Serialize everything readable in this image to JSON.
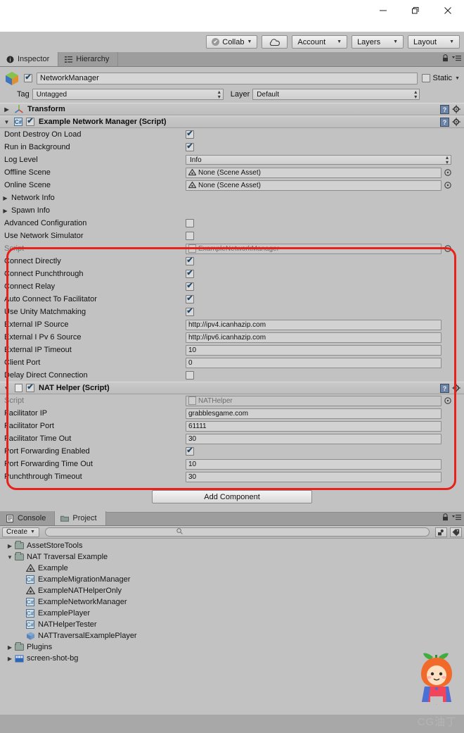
{
  "window": {
    "minimize_label": "Minimize",
    "maximize_label": "Restore",
    "close_label": "Close"
  },
  "toolbar": {
    "collab_label": "Collab",
    "cloud_label": "cloud-icon",
    "account_label": "Account",
    "layers_label": "Layers",
    "layout_label": "Layout"
  },
  "inspector": {
    "tabs": [
      {
        "label": "Inspector",
        "icon": "info-icon",
        "active": true
      },
      {
        "label": "Hierarchy",
        "icon": "hierarchy-icon",
        "active": false
      }
    ],
    "lock_icon": "lock-icon",
    "menu_icon": "panel-menu-icon",
    "object": {
      "enabled": true,
      "name": "NetworkManager",
      "static_label": "Static",
      "static_checked": false,
      "tag_label": "Tag",
      "tag_value": "Untagged",
      "layer_label": "Layer",
      "layer_value": "Default"
    },
    "components": [
      {
        "title": "Transform",
        "expanded": false,
        "has_enable_toggle": false,
        "icon": "transform-icon"
      },
      {
        "title": "Example Network Manager (Script)",
        "expanded": true,
        "has_enable_toggle": true,
        "enabled": true,
        "icon": "csharp-script-icon",
        "rows": [
          {
            "label": "Dont Destroy On Load",
            "type": "checkbox",
            "value": true
          },
          {
            "label": "Run in Background",
            "type": "checkbox",
            "value": true
          },
          {
            "label": "Log Level",
            "type": "dropdown",
            "value": "Info"
          },
          {
            "label": "Offline Scene",
            "type": "objectref",
            "value": "None (Scene Asset)"
          },
          {
            "label": "Online Scene",
            "type": "objectref",
            "value": "None (Scene Asset)"
          },
          {
            "label": "Network Info",
            "type": "foldout"
          },
          {
            "label": "Spawn Info",
            "type": "foldout"
          },
          {
            "label": "Advanced Configuration",
            "type": "checkbox",
            "value": false
          },
          {
            "label": "Use Network Simulator",
            "type": "checkbox",
            "value": false
          },
          {
            "label": "Script",
            "type": "scriptref",
            "value": "ExampleNetworkManager",
            "dim": true
          },
          {
            "label": "Connect Directly",
            "type": "checkbox",
            "value": true
          },
          {
            "label": "Connect Punchthrough",
            "type": "checkbox",
            "value": true
          },
          {
            "label": "Connect Relay",
            "type": "checkbox",
            "value": true
          },
          {
            "label": "Auto Connect To Facilitator",
            "type": "checkbox",
            "value": true
          },
          {
            "label": "Use Unity Matchmaking",
            "type": "checkbox",
            "value": true
          },
          {
            "label": "External IP Source",
            "type": "text",
            "value": "http://ipv4.icanhazip.com"
          },
          {
            "label": "External I Pv 6 Source",
            "type": "text",
            "value": "http://ipv6.icanhazip.com"
          },
          {
            "label": "External IP Timeout",
            "type": "text",
            "value": "10"
          },
          {
            "label": "Client Port",
            "type": "text",
            "value": "0"
          },
          {
            "label": "Delay Direct Connection",
            "type": "checkbox",
            "value": false
          }
        ]
      },
      {
        "title": "NAT Helper (Script)",
        "expanded": true,
        "has_enable_toggle": true,
        "enabled": true,
        "icon": "script-icon",
        "rows": [
          {
            "label": "Script",
            "type": "scriptref",
            "value": "NATHelper",
            "dim": true
          },
          {
            "label": "Facilitator IP",
            "type": "text",
            "value": "grabblesgame.com"
          },
          {
            "label": "Facilitator Port",
            "type": "text",
            "value": "61111"
          },
          {
            "label": "Facilitator Time Out",
            "type": "text",
            "value": "30"
          },
          {
            "label": "Port Forwarding Enabled",
            "type": "checkbox",
            "value": true
          },
          {
            "label": "Port Forwarding Time Out",
            "type": "text",
            "value": "10"
          },
          {
            "label": "Punchthrough Timeout",
            "type": "text",
            "value": "30"
          }
        ]
      }
    ],
    "add_component_label": "Add Component",
    "highlight_color": "#e8211b"
  },
  "project": {
    "tabs": [
      {
        "label": "Console",
        "icon": "console-icon",
        "active": false
      },
      {
        "label": "Project",
        "icon": "folder-icon",
        "active": true
      }
    ],
    "lock_icon": "lock-icon",
    "menu_icon": "panel-menu-icon",
    "create_label": "Create",
    "search_placeholder": "",
    "search_icon": "search-icon",
    "filter_type_icon": "filter-by-type-icon",
    "filter_label_icon": "filter-by-label-icon",
    "tree": [
      {
        "label": "AssetStoreTools",
        "icon": "folder",
        "depth": 0,
        "arrow": "collapsed"
      },
      {
        "label": "NAT Traversal Example",
        "icon": "folder",
        "depth": 0,
        "arrow": "expanded"
      },
      {
        "label": "Example",
        "icon": "unity-scene",
        "depth": 1,
        "arrow": "none"
      },
      {
        "label": "ExampleMigrationManager",
        "icon": "csharp",
        "depth": 1,
        "arrow": "none"
      },
      {
        "label": "ExampleNATHelperOnly",
        "icon": "unity-scene",
        "depth": 1,
        "arrow": "none"
      },
      {
        "label": "ExampleNetworkManager",
        "icon": "csharp",
        "depth": 1,
        "arrow": "none"
      },
      {
        "label": "ExamplePlayer",
        "icon": "csharp",
        "depth": 1,
        "arrow": "none"
      },
      {
        "label": "NATHelperTester",
        "icon": "csharp",
        "depth": 1,
        "arrow": "none"
      },
      {
        "label": "NATTraversalExamplePlayer",
        "icon": "prefab",
        "depth": 1,
        "arrow": "none"
      },
      {
        "label": "Plugins",
        "icon": "folder",
        "depth": 0,
        "arrow": "collapsed"
      },
      {
        "label": "screen-shot-bg",
        "icon": "image",
        "depth": 0,
        "arrow": "collapsed"
      }
    ]
  },
  "watermark": {
    "text": "CG油丁",
    "mascot": "orange-character-mascot"
  }
}
